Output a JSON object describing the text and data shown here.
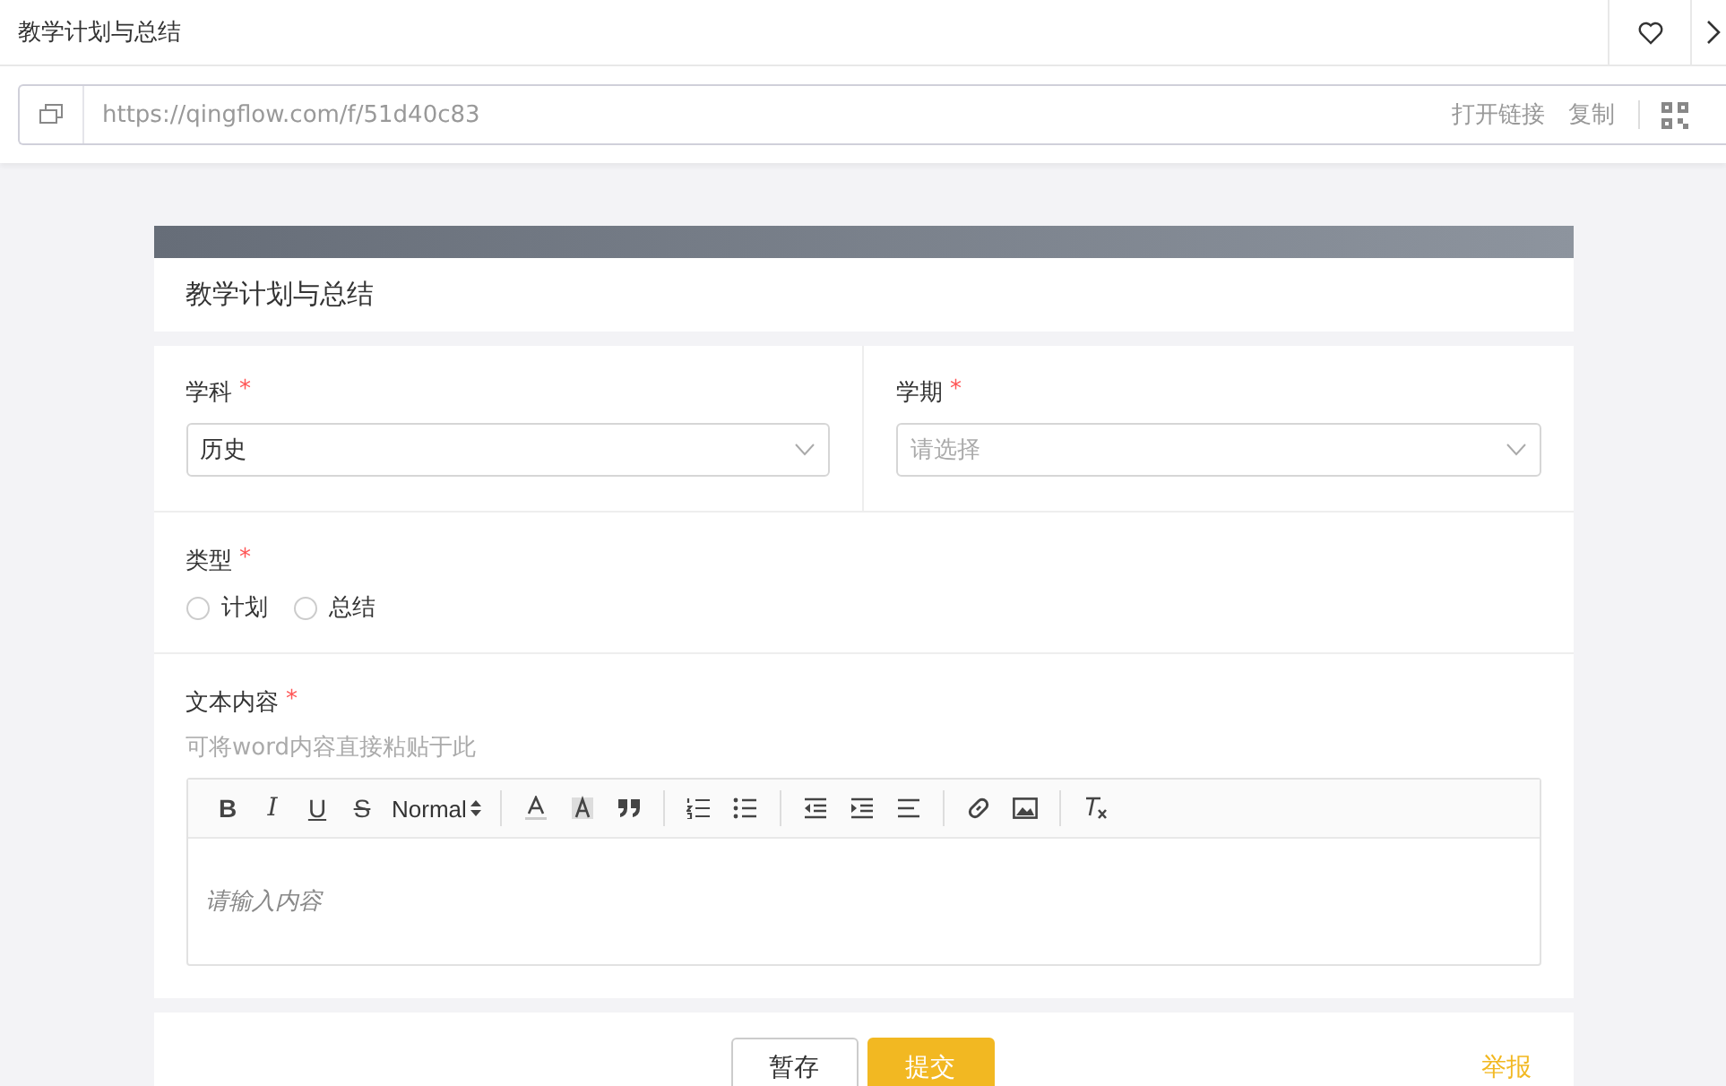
{
  "window": {
    "title": "教学计划与总结"
  },
  "link_bar": {
    "url": "https://qingflow.com/f/51d40c83",
    "actions": [
      "打开链接",
      "复制"
    ]
  },
  "form": {
    "title": "教学计划与总结",
    "selects": [
      {
        "label": "学科",
        "required_mark": "*",
        "value": "历史"
      },
      {
        "label": "学期",
        "required_mark": "*",
        "placeholder": "请选择"
      }
    ],
    "radio_group": {
      "label": "类型",
      "required_mark": "*",
      "options": [
        {
          "label": "计划",
          "selected": false
        },
        {
          "label": "总结",
          "selected": false
        }
      ]
    },
    "rich_text": {
      "label": "文本内容",
      "required_mark": "*",
      "hint": "可将word内容直接粘贴于此",
      "format_buttons": [
        {
          "kind": "bold",
          "text": "B"
        },
        {
          "kind": "italic",
          "text": "I"
        },
        {
          "kind": "underline",
          "text": "U"
        },
        {
          "kind": "strike",
          "text": "S"
        }
      ],
      "header_select": "Normal",
      "placeholder": "请输入内容"
    }
  },
  "footer": {
    "buttons": [
      {
        "label": "暂存",
        "kind": "secondary"
      },
      {
        "label": "提交",
        "kind": "primary"
      }
    ],
    "report_link": "举报"
  }
}
